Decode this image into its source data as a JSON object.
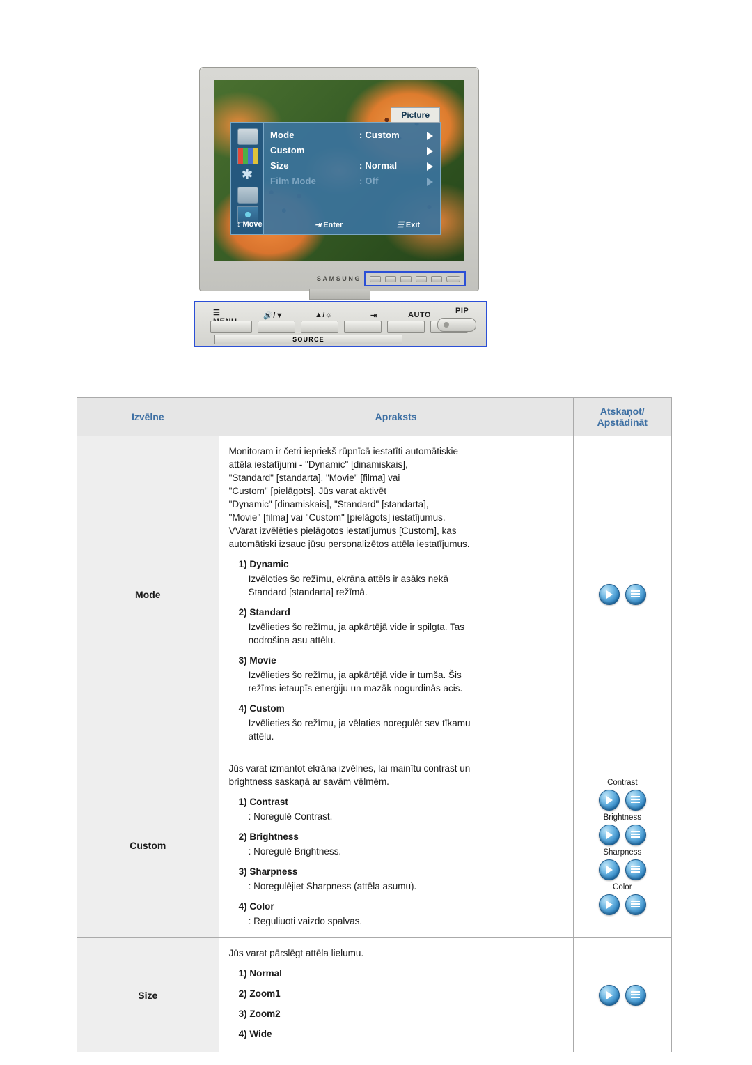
{
  "illustration": {
    "osd": {
      "title": "Picture",
      "rows": [
        {
          "label": "Mode",
          "value": ": Custom",
          "dim": false
        },
        {
          "label": "Custom",
          "value": "",
          "dim": false
        },
        {
          "label": "Size",
          "value": ": Normal",
          "dim": false
        },
        {
          "label": "Film Mode",
          "value": ": Off",
          "dim": true
        }
      ],
      "footer": {
        "move": "Move",
        "enter": "Enter",
        "exit": "Exit"
      }
    },
    "brand": "SAMSUNG",
    "front_panel": {
      "menu": "MENU",
      "volume": "/",
      "brightness": "/",
      "auto": "AUTO",
      "pip": "PIP",
      "source": "SOURCE"
    }
  },
  "table": {
    "headers": {
      "menu": "Izvēlne",
      "description": "Apraksts",
      "reset_line1": "Atskaņot/",
      "reset_line2": "Apstādināt"
    },
    "rows": [
      {
        "menu": "Mode",
        "lead": [
          "Monitoram ir četri iepriekš rūpnīcā iestatīti automātiskie",
          "attēla iestatījumi - \"Dynamic\" [dinamiskais],",
          "\"Standard\" [standarta], \"Movie\" [filma] vai",
          "\"Custom\" [pielāgots]. Jūs varat aktivēt",
          "\"Dynamic\" [dinamiskais], \"Standard\" [standarta],",
          "\"Movie\" [filma] vai \"Custom\" [pielāgots] iestatījumus.",
          "VVarat izvēlēties pielāgotos iestatījumus [Custom], kas",
          "automātiski izsauc jūsu personalizētos attēla iestatījumus."
        ],
        "items": [
          {
            "num": "1)",
            "title": "Dynamic",
            "lines": [
              "Izvēloties šo režīmu, ekrāna attēls ir asāks nekā",
              "Standard [standarta] režīmā."
            ]
          },
          {
            "num": "2)",
            "title": "Standard",
            "lines": [
              "Izvēlieties šo režīmu, ja apkārtējā vide ir spilgta. Tas",
              "nodrošina asu attēlu."
            ]
          },
          {
            "num": "3)",
            "title": "Movie",
            "lines": [
              "Izvēlieties šo režīmu, ja apkārtējā vide ir tumša. Šis",
              "režīms ietaupīs enerģiju un mazāk nogurdinās acis."
            ]
          },
          {
            "num": "4)",
            "title": "Custom",
            "lines": [
              "Izvēlieties šo režīmu, ja vēlaties noregulēt sev tīkamu",
              "attēlu."
            ]
          }
        ],
        "reset_groups": [
          {
            "label": "",
            "buttons": [
              "play-icon",
              "menu-icon"
            ]
          }
        ]
      },
      {
        "menu": "Custom",
        "lead": [
          "Jūs varat izmantot ekrāna izvēlnes, lai mainītu contrast un",
          "brightness saskaņā ar savām vēlmēm."
        ],
        "items": [
          {
            "num": "1)",
            "title": "Contrast",
            "lines": [
              ": Noregulē Contrast."
            ]
          },
          {
            "num": "2)",
            "title": "Brightness",
            "lines": [
              ": Noregulē Brightness."
            ]
          },
          {
            "num": "3)",
            "title": "Sharpness",
            "lines": [
              ": Noregulējiet Sharpness (attēla asumu)."
            ]
          },
          {
            "num": "4)",
            "title": "Color",
            "lines": [
              ": Reguliuoti vaizdo spalvas."
            ]
          }
        ],
        "reset_groups": [
          {
            "label": "Contrast",
            "buttons": [
              "play-icon",
              "menu-icon"
            ]
          },
          {
            "label": "Brightness",
            "buttons": [
              "play-icon",
              "menu-icon"
            ]
          },
          {
            "label": "Sharpness",
            "buttons": [
              "play-icon",
              "menu-icon"
            ]
          },
          {
            "label": "Color",
            "buttons": [
              "play-icon",
              "menu-icon"
            ]
          }
        ]
      },
      {
        "menu": "Size",
        "lead": [
          "Jūs varat pārslēgt attēla lielumu."
        ],
        "items": [
          {
            "num": "1)",
            "title": "Normal",
            "lines": []
          },
          {
            "num": "2)",
            "title": "Zoom1",
            "lines": []
          },
          {
            "num": "3)",
            "title": "Zoom2",
            "lines": []
          },
          {
            "num": "4)",
            "title": "Wide",
            "lines": []
          }
        ],
        "reset_groups": [
          {
            "label": "",
            "buttons": [
              "play-icon",
              "menu-icon"
            ]
          }
        ]
      }
    ]
  },
  "colors": {
    "header_text": "#3d6fa3",
    "osd_bg": "#3b739d",
    "highlight_border": "#2b4fd6"
  }
}
